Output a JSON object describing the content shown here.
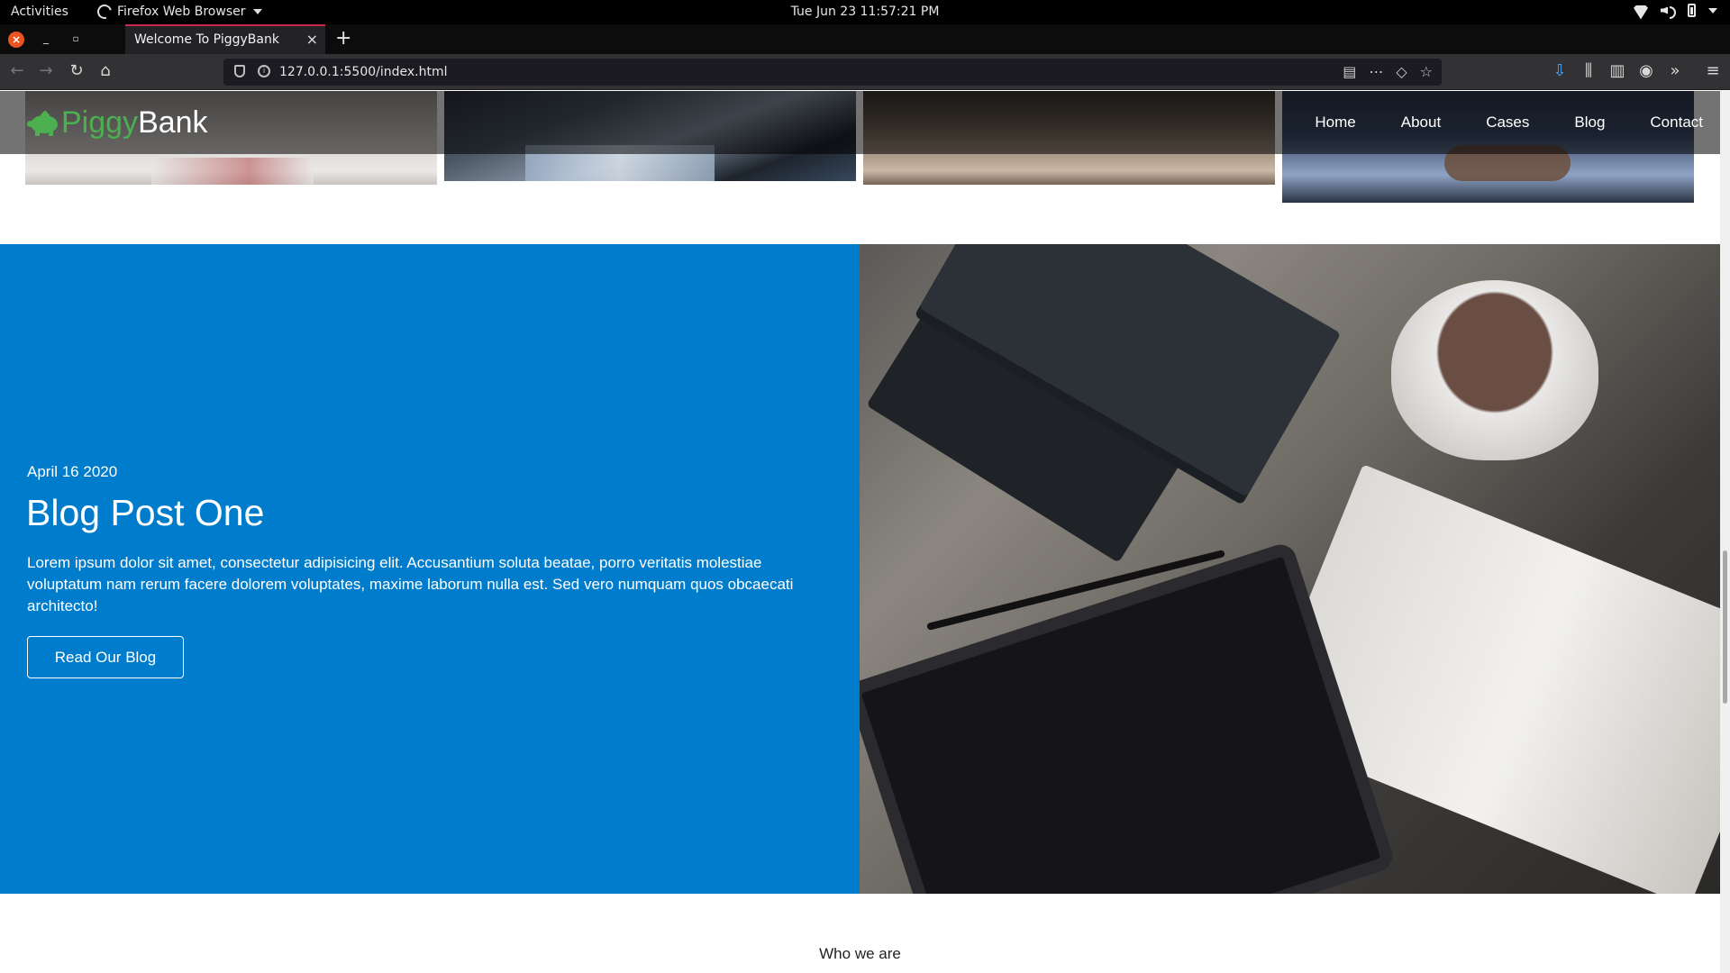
{
  "system": {
    "activities": "Activities",
    "app_name": "Firefox Web Browser",
    "clock": "Tue Jun 23  11:57:21 PM"
  },
  "browser": {
    "tab_title": "Welcome To PiggyBank",
    "url": "127.0.0.1:5500/index.html"
  },
  "site": {
    "logo_part1": "Piggy",
    "logo_part2": "Bank",
    "nav": [
      "Home",
      "About",
      "Cases",
      "Blog",
      "Contact"
    ],
    "colors": {
      "accent_green": "#4caf50",
      "blog_blue": "#007ccc"
    }
  },
  "blog": {
    "date": "April 16 2020",
    "title": "Blog Post One",
    "text": "Lorem ipsum dolor sit amet, consectetur adipisicing elit. Accusantium soluta beatae, porro veritatis molestiae voluptatum nam rerum facere dolorem voluptates, maxime laborum nulla est. Sed vero numquam quos obcaecati architecto!",
    "button": "Read Our Blog"
  },
  "who": {
    "heading": "Who we are"
  }
}
